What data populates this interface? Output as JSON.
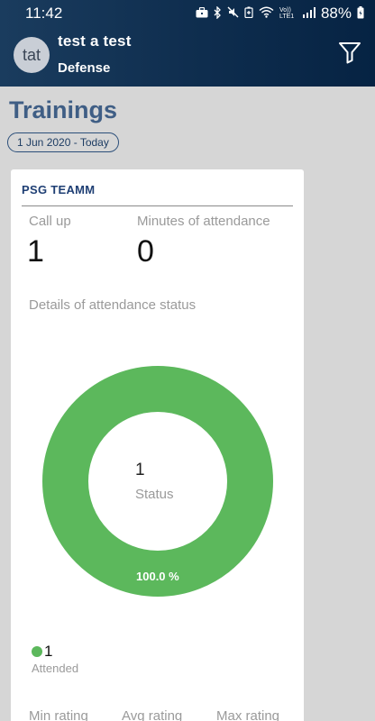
{
  "status_bar": {
    "time": "11:42",
    "icons": [
      "briefcase-icon",
      "bluetooth-icon",
      "mute-icon",
      "battery-saver-icon",
      "wifi-icon",
      "signal-icon",
      "battery-icon"
    ],
    "network": "Vo)) LTE1",
    "battery": "88%"
  },
  "header": {
    "avatar_initials": "tat",
    "user_name": "test a test",
    "role": "Defense",
    "filter_icon": "filter-icon"
  },
  "page": {
    "title": "Trainings",
    "date_range": "1 Jun 2020 - Today"
  },
  "card": {
    "team_name": "PSG TEAMM",
    "call_up_label": "Call up",
    "call_up_value": "1",
    "minutes_label": "Minutes of attendance",
    "minutes_value": "0",
    "details_label": "Details of attendance status",
    "donut": {
      "center_value": "1",
      "center_label": "Status",
      "percent_label": "100.0 %",
      "segments": [
        {
          "name": "Attended",
          "value": 1,
          "color": "#5cb85c"
        }
      ]
    },
    "legend": [
      {
        "count": "1",
        "label": "Attended",
        "color": "#5cb85c"
      }
    ],
    "ratings": {
      "min_label": "Min rating",
      "avg_label": "Avg rating",
      "max_label": "Max rating"
    }
  },
  "colors": {
    "header_start": "#1a3c5e",
    "header_end": "#062343",
    "title": "#3f5e85",
    "accent_green": "#5cb85c",
    "background": "#d6d6d6"
  }
}
